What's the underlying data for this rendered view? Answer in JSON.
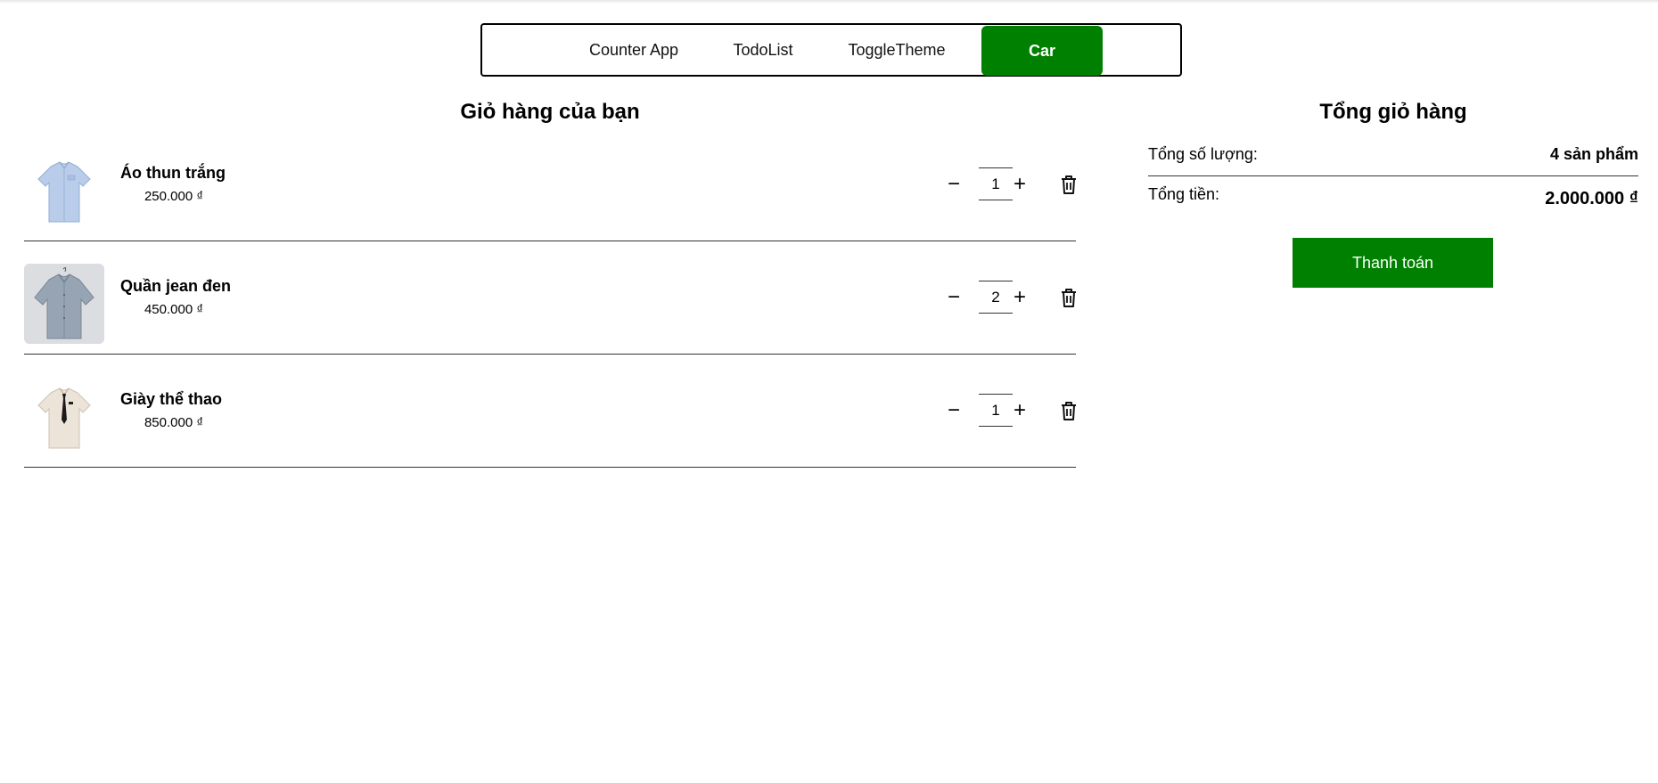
{
  "nav": {
    "items": [
      {
        "label": "Counter App",
        "active": false
      },
      {
        "label": "TodoList",
        "active": false
      },
      {
        "label": "ToggleTheme",
        "active": false
      },
      {
        "label": "Car",
        "active": true
      }
    ],
    "active_color": "#008000"
  },
  "cart": {
    "title": "Giỏ hàng của bạn",
    "items": [
      {
        "name": "Áo thun trắng",
        "price": "250.000 ₫",
        "quantity": "1",
        "image_icon": "light-blue-shirt-icon"
      },
      {
        "name": "Quần jean đen",
        "price": "450.000 ₫",
        "quantity": "2",
        "image_icon": "grey-shirt-icon"
      },
      {
        "name": "Giày thể thao",
        "price": "850.000 ₫",
        "quantity": "1",
        "image_icon": "cream-shirt-with-tie-icon"
      }
    ],
    "minus_symbol": "−",
    "plus_symbol": "+"
  },
  "summary": {
    "title": "Tổng giỏ hàng",
    "quantity_label": "Tổng số lượng:",
    "quantity_value": "4 sản phẩm",
    "total_label": "Tổng tiền:",
    "total_value": "2.000.000 ₫",
    "checkout_label": "Thanh toán",
    "button_color": "#008000"
  }
}
